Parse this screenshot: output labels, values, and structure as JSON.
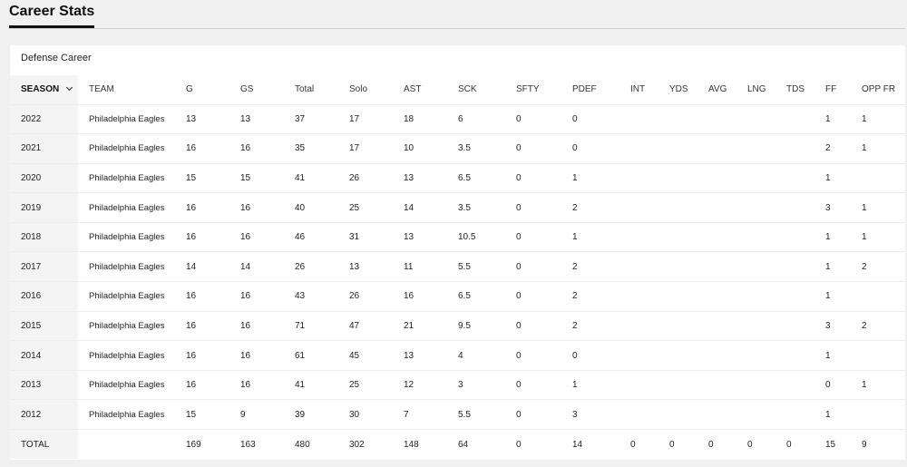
{
  "page": {
    "title": "Career Stats"
  },
  "section": {
    "title": "Defense Career"
  },
  "table": {
    "columns": [
      "SEASON",
      "TEAM",
      "G",
      "GS",
      "Total",
      "Solo",
      "AST",
      "SCK",
      "SFTY",
      "PDEF",
      "INT",
      "YDS",
      "AVG",
      "LNG",
      "TDS",
      "FF",
      "OPP FR"
    ],
    "rows": [
      [
        "2022",
        "Philadelphia Eagles",
        "13",
        "13",
        "37",
        "17",
        "18",
        "6",
        "0",
        "0",
        "",
        "",
        "",
        "",
        "",
        "1",
        "1"
      ],
      [
        "2021",
        "Philadelphia Eagles",
        "16",
        "16",
        "35",
        "17",
        "10",
        "3.5",
        "0",
        "0",
        "",
        "",
        "",
        "",
        "",
        "2",
        "1"
      ],
      [
        "2020",
        "Philadelphia Eagles",
        "15",
        "15",
        "41",
        "26",
        "13",
        "6.5",
        "0",
        "1",
        "",
        "",
        "",
        "",
        "",
        "1",
        ""
      ],
      [
        "2019",
        "Philadelphia Eagles",
        "16",
        "16",
        "40",
        "25",
        "14",
        "3.5",
        "0",
        "2",
        "",
        "",
        "",
        "",
        "",
        "3",
        "1"
      ],
      [
        "2018",
        "Philadelphia Eagles",
        "16",
        "16",
        "46",
        "31",
        "13",
        "10.5",
        "0",
        "1",
        "",
        "",
        "",
        "",
        "",
        "1",
        "1"
      ],
      [
        "2017",
        "Philadelphia Eagles",
        "14",
        "14",
        "26",
        "13",
        "11",
        "5.5",
        "0",
        "2",
        "",
        "",
        "",
        "",
        "",
        "1",
        "2"
      ],
      [
        "2016",
        "Philadelphia Eagles",
        "16",
        "16",
        "43",
        "26",
        "16",
        "6.5",
        "0",
        "2",
        "",
        "",
        "",
        "",
        "",
        "1",
        ""
      ],
      [
        "2015",
        "Philadelphia Eagles",
        "16",
        "16",
        "71",
        "47",
        "21",
        "9.5",
        "0",
        "2",
        "",
        "",
        "",
        "",
        "",
        "3",
        "2"
      ],
      [
        "2014",
        "Philadelphia Eagles",
        "16",
        "16",
        "61",
        "45",
        "13",
        "4",
        "0",
        "0",
        "",
        "",
        "",
        "",
        "",
        "1",
        ""
      ],
      [
        "2013",
        "Philadelphia Eagles",
        "16",
        "16",
        "41",
        "25",
        "12",
        "3",
        "0",
        "1",
        "",
        "",
        "",
        "",
        "",
        "0",
        "1"
      ],
      [
        "2012",
        "Philadelphia Eagles",
        "15",
        "9",
        "39",
        "30",
        "7",
        "5.5",
        "0",
        "3",
        "",
        "",
        "",
        "",
        "",
        "1",
        ""
      ],
      [
        "TOTAL",
        "",
        "169",
        "163",
        "480",
        "302",
        "148",
        "64",
        "0",
        "14",
        "0",
        "0",
        "0",
        "0",
        "0",
        "15",
        "9"
      ]
    ]
  },
  "colors": {
    "background": "#f0f0f0",
    "card": "#ffffff",
    "season_column": "#f4f4f4"
  },
  "icons": {
    "sort": "chevron-down-icon"
  }
}
